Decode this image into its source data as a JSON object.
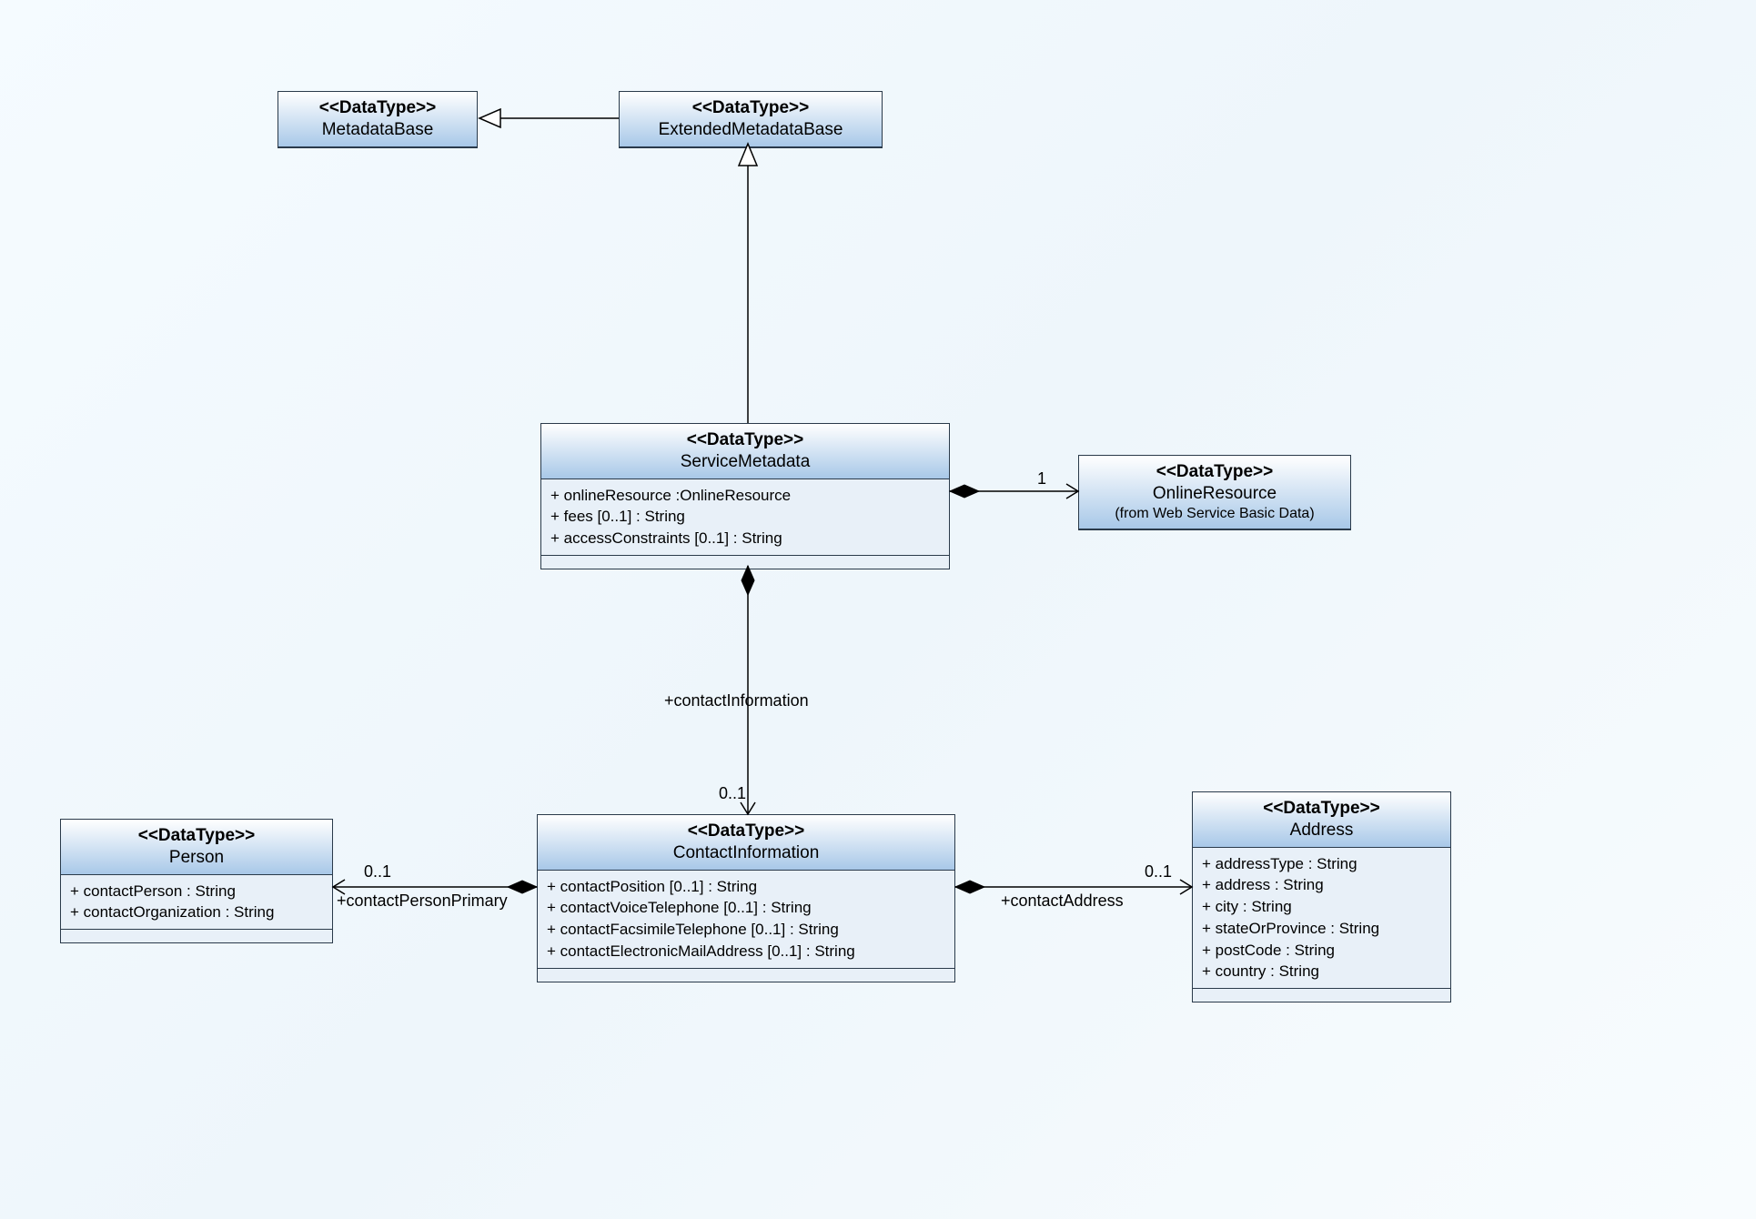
{
  "classes": {
    "metadataBase": {
      "stereo": "<<DataType>>",
      "name": "MetadataBase"
    },
    "extendedMetadataBase": {
      "stereo": "<<DataType>>",
      "name": "ExtendedMetadataBase"
    },
    "serviceMetadata": {
      "stereo": "<<DataType>>",
      "name": "ServiceMetadata",
      "attrs": [
        "+ onlineResource :OnlineResource",
        "+ fees [0..1] : String",
        "+ accessConstraints [0..1] : String"
      ]
    },
    "onlineResource": {
      "stereo": "<<DataType>>",
      "name": "OnlineResource",
      "from": "(from Web Service Basic Data)"
    },
    "contactInformation": {
      "stereo": "<<DataType>>",
      "name": "ContactInformation",
      "attrs": [
        "+ contactPosition [0..1] : String",
        "+ contactVoiceTelephone [0..1] : String",
        "+ contactFacsimileTelephone [0..1] : String",
        "+ contactElectronicMailAddress [0..1] : String"
      ]
    },
    "person": {
      "stereo": "<<DataType>>",
      "name": "Person",
      "attrs": [
        "+ contactPerson : String",
        "+ contactOrganization : String"
      ]
    },
    "address": {
      "stereo": "<<DataType>>",
      "name": "Address",
      "attrs": [
        "+ addressType : String",
        "+ address : String",
        "+ city : String",
        "+ stateOrProvince : String",
        "+ postCode : String",
        "+ country : String"
      ]
    }
  },
  "labels": {
    "contactInformationRole": "+contactInformation",
    "contactInformationMult": "0..1",
    "onlineResourceMult": "1",
    "personMult": "0..1",
    "personRole": "+contactPersonPrimary",
    "addressMult": "0..1",
    "addressRole": "+contactAddress"
  }
}
